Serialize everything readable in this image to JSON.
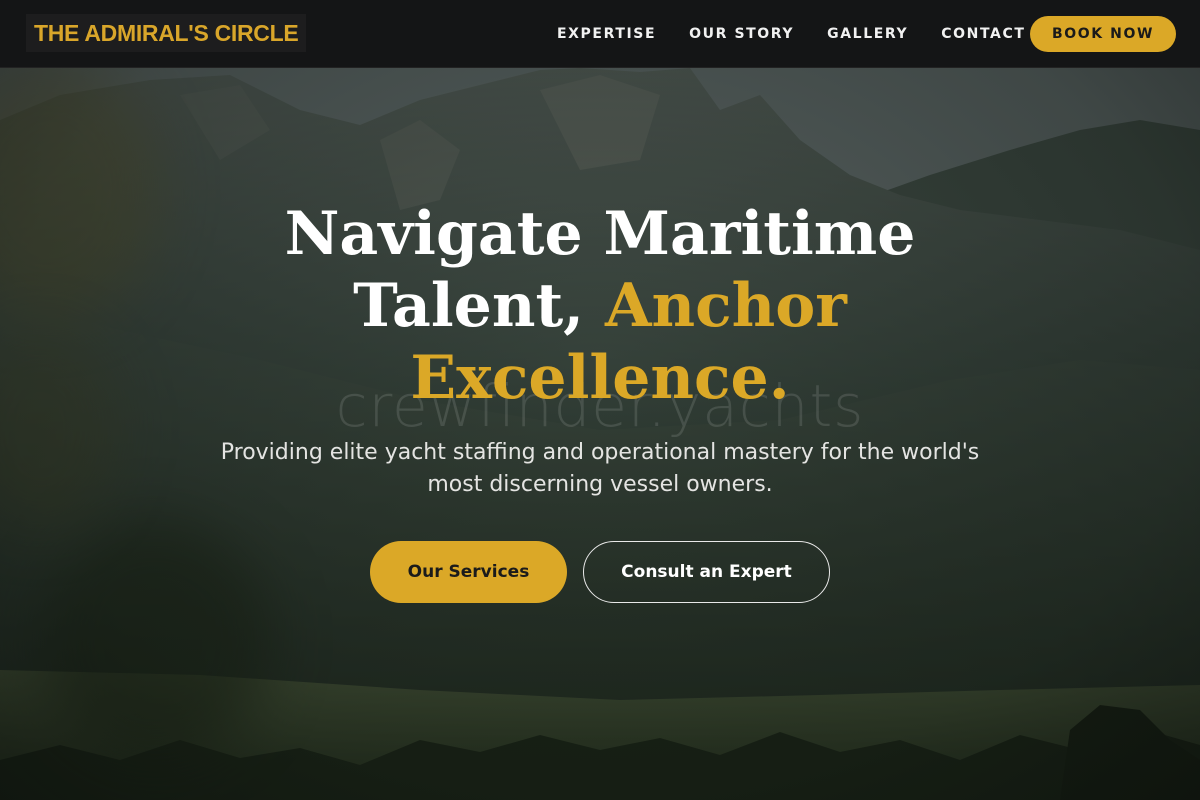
{
  "brand": {
    "name": "THE ADMIRAL'S CIRCLE",
    "color": "#d9a62a"
  },
  "nav": {
    "links": [
      {
        "label": "EXPERTISE"
      },
      {
        "label": "OUR STORY"
      },
      {
        "label": "GALLERY"
      },
      {
        "label": "CONTACT"
      }
    ],
    "cta_label": "BOOK NOW"
  },
  "hero": {
    "headline_line1": "Navigate Maritime",
    "headline_line2_white": "Talent, ",
    "headline_line2_accent": "Anchor",
    "headline_line3_accent": "Excellence.",
    "subtitle": "Providing elite yacht staffing and operational mastery for the world's most discerning vessel owners.",
    "primary_button": "Our Services",
    "secondary_button": "Consult an Expert",
    "watermark": "crewfinder.yachts"
  },
  "colors": {
    "accent": "#dba827",
    "navbar_bg": "#141516",
    "headline": "#ffffff"
  }
}
